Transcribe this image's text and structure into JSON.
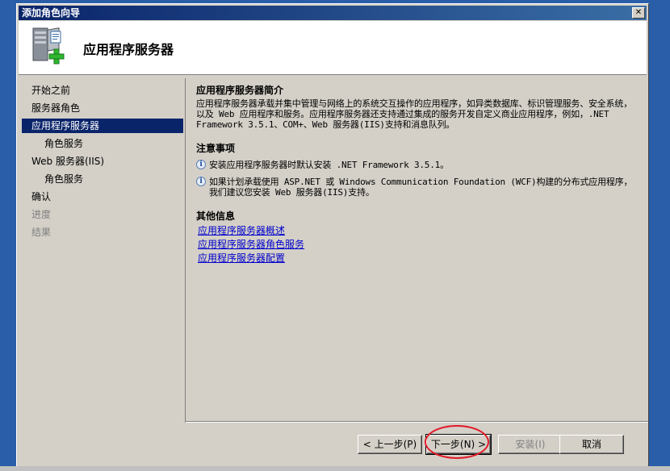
{
  "window": {
    "title": "添加角色向导",
    "close_label": "✕"
  },
  "header": {
    "title": "应用程序服务器",
    "icon": "server-add-icon"
  },
  "nav": {
    "items": [
      {
        "label": "开始之前",
        "state": "normal"
      },
      {
        "label": "服务器角色",
        "state": "normal"
      },
      {
        "label": "应用程序服务器",
        "state": "active"
      },
      {
        "label": "角色服务",
        "state": "sub"
      },
      {
        "label": "Web 服务器(IIS)",
        "state": "normal"
      },
      {
        "label": "角色服务",
        "state": "sub"
      },
      {
        "label": "确认",
        "state": "normal"
      },
      {
        "label": "进度",
        "state": "disabled"
      },
      {
        "label": "结果",
        "state": "disabled"
      }
    ]
  },
  "content": {
    "intro_heading": "应用程序服务器简介",
    "intro_text": "应用程序服务器承载并集中管理与网络上的系统交互操作的应用程序，如异类数据库、标识管理服务、安全系统，以及 Web 应用程序和服务。应用程序服务器还支持通过集成的服务开发自定义商业应用程序，例如，.NET Framework 3.5.1、COM+、Web 服务器(IIS)支持和消息队列。",
    "notes_heading": "注意事项",
    "notes": [
      "安装应用程序服务器时默认安装 .NET Framework 3.5.1。",
      "如果计划承载使用 ASP.NET 或 Windows Communication Foundation (WCF)构建的分布式应用程序，我们建议您安装 Web 服务器(IIS)支持。"
    ],
    "info_heading": "其他信息",
    "links": [
      "应用程序服务器概述",
      "应用程序服务器角色服务",
      "应用程序服务器配置"
    ]
  },
  "buttons": {
    "prev": "< 上一步(P)",
    "next": "下一步(N) >",
    "install": "安装(I)",
    "cancel": "取消"
  },
  "colors": {
    "titlebar": "#0a246a",
    "highlight": "#0a246a",
    "annotation_circle": "#e21a28",
    "link": "#0000cc"
  }
}
